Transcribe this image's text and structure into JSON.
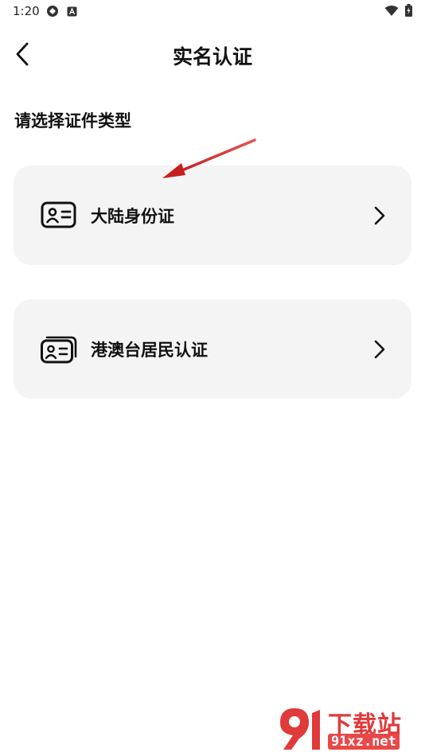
{
  "status_bar": {
    "time": "1:20",
    "icons": [
      "sync-icon",
      "a-badge-icon",
      "wifi-icon",
      "battery-icon"
    ]
  },
  "header": {
    "title": "实名认证",
    "back_icon": "chevron-left-icon"
  },
  "section": {
    "title": "请选择证件类型"
  },
  "options": [
    {
      "label": "大陆身份证",
      "icon": "id-card-icon"
    },
    {
      "label": "港澳台居民认证",
      "icon": "id-cards-stack-icon"
    }
  ],
  "watermark": {
    "logo": "91-logo",
    "text_top": "下载站",
    "text_bottom": "91xz.net"
  },
  "colors": {
    "card_bg": "#f4f4f4",
    "annotation_arrow": "#d92b2b",
    "watermark_red": "#e03a3a"
  }
}
